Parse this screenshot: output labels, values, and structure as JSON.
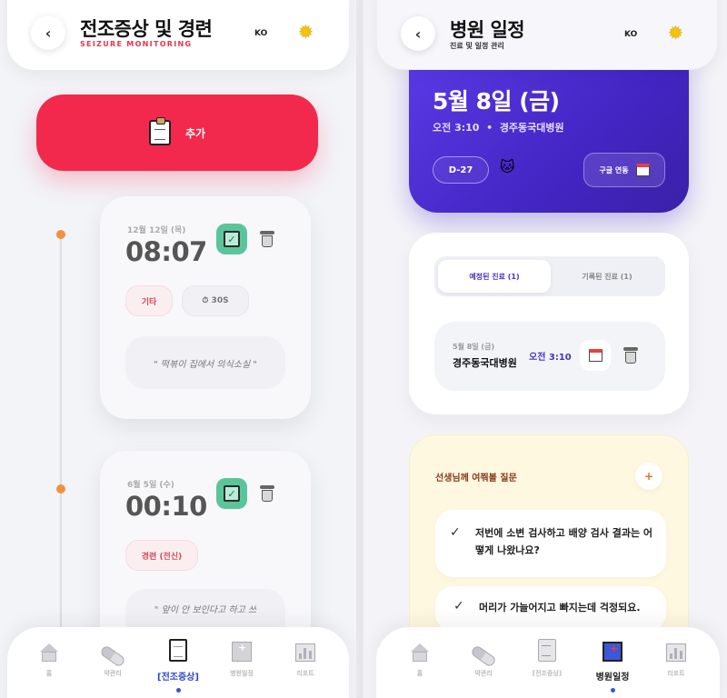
{
  "left": {
    "header": {
      "back": "‹",
      "title": "전조증상 및 경련",
      "subtitle": "SEIZURE MONITORING",
      "lang": "KO"
    },
    "add_button": {
      "label": "추가"
    },
    "records": [
      {
        "date": "12월 12일 (목)",
        "time": "08:07",
        "tags": [
          "기타",
          "⏱ 30S"
        ],
        "note": "\" 떡볶이 집에서 의식소실 \""
      },
      {
        "date": "6월 5일 (수)",
        "time": "00:10",
        "tags": [
          "경련 (전신)"
        ],
        "note": "\" 앞이 안 보인다고 하고 쓰"
      }
    ],
    "nav": [
      {
        "label": "홈"
      },
      {
        "label": "약관리"
      },
      {
        "label": "[전조증상]"
      },
      {
        "label": "병원일정"
      },
      {
        "label": "리포트"
      }
    ]
  },
  "right": {
    "header": {
      "back": "‹",
      "title": "병원 일정",
      "subtitle": "진료 및 일정 관리",
      "lang": "KO"
    },
    "hero": {
      "date": "5월 8일 (금)",
      "time": "오전 3:10",
      "separator": "•",
      "hospital": "경주동국대병원",
      "dday": "D-27",
      "gcal_label": "구글 연동"
    },
    "tabs": {
      "scheduled": "예정된 진료 (1)",
      "recorded": "기록된 진료 (1)"
    },
    "appointment": {
      "date": "5월 8일 (금)",
      "hospital": "경주동국대병원",
      "time": "오전 3:10"
    },
    "questions": {
      "title": "선생님께 여쭤볼 질문",
      "add": "+",
      "items": [
        {
          "check": "✓",
          "text": "저번에 소변 검사하고 배양 검사 결과는 어떻게 나왔나요?"
        },
        {
          "check": "✓",
          "text": "머리가 가늘어지고 빠지는데 걱정되요."
        }
      ]
    },
    "nav": [
      {
        "label": "홈"
      },
      {
        "label": "약관리"
      },
      {
        "label": "[전조증상]"
      },
      {
        "label": "병원일정"
      },
      {
        "label": "리포트"
      }
    ]
  },
  "colors": {
    "accent_red": "#f2294c",
    "purple": "#4b2fc9",
    "active_nav": "#2c48c8",
    "success": "#5bc59a"
  },
  "icons": {
    "back": "chevron-left-icon",
    "theme": "sun-icon",
    "add": "clipboard-icon",
    "check": "checkbox-icon",
    "delete": "trash-icon"
  }
}
